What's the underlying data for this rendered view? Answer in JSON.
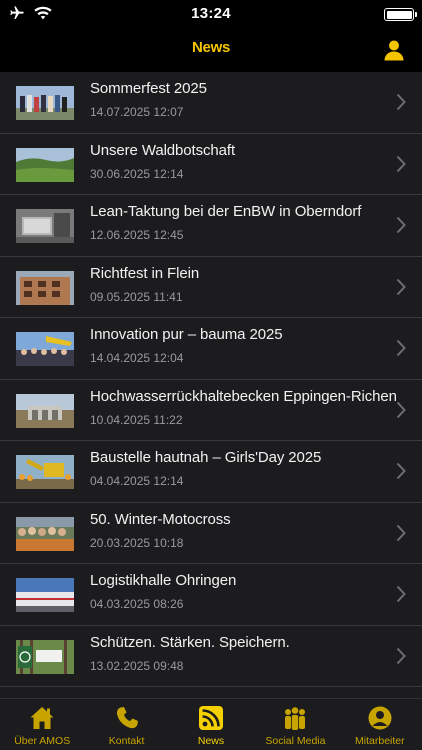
{
  "status_bar": {
    "time": "13:24",
    "icons": [
      "airplane-icon",
      "wifi-icon",
      "battery-icon"
    ]
  },
  "header": {
    "title": "News",
    "right_icon": "user-icon"
  },
  "colors": {
    "accent": "#f5c400",
    "list_background": "#1c1c1e",
    "separator": "#39393c",
    "date_text": "#9a9a9e"
  },
  "news": [
    {
      "title": "Sommerfest 2025",
      "date": "14.07.2025 12:07",
      "thumbnail": "group-photo-outdoor"
    },
    {
      "title": "Unsere Waldbotschaft",
      "date": "30.06.2025 12:14",
      "thumbnail": "forest-landscape"
    },
    {
      "title": "Lean-Taktung bei der EnBW in Oberndorf",
      "date": "12.06.2025 12:45",
      "thumbnail": "concrete-building-site"
    },
    {
      "title": "Richtfest in Flein",
      "date": "09.05.2025 11:41",
      "thumbnail": "building-facade"
    },
    {
      "title": "Innovation pur – bauma 2025",
      "date": "14.04.2025 12:04",
      "thumbnail": "trade-fair-crowd"
    },
    {
      "title": "Hochwasserrückhaltebecken Eppingen-Richen",
      "date": "10.04.2025 11:22",
      "thumbnail": "dam-construction"
    },
    {
      "title": "Baustelle hautnah – Girls'Day 2025",
      "date": "04.04.2025 12:14",
      "thumbnail": "excavator-group"
    },
    {
      "title": "50. Winter-Motocross",
      "date": "20.03.2025 10:18",
      "thumbnail": "group-photo-crowd"
    },
    {
      "title": "Logistikhalle Ohringen",
      "date": "04.03.2025 08:26",
      "thumbnail": "logistics-hall"
    },
    {
      "title": "Schützen. Stärken. Speichern.",
      "date": "13.02.2025 09:48",
      "thumbnail": "forest-logo"
    }
  ],
  "tabs": [
    {
      "label": "Über AMOS",
      "icon": "house-icon",
      "active": false
    },
    {
      "label": "Kontakt",
      "icon": "phone-icon",
      "active": false
    },
    {
      "label": "News",
      "icon": "rss-icon",
      "active": true
    },
    {
      "label": "Social Media",
      "icon": "people-icon",
      "active": false
    },
    {
      "label": "Mitarbeiter",
      "icon": "person-circle-icon",
      "active": false
    }
  ]
}
